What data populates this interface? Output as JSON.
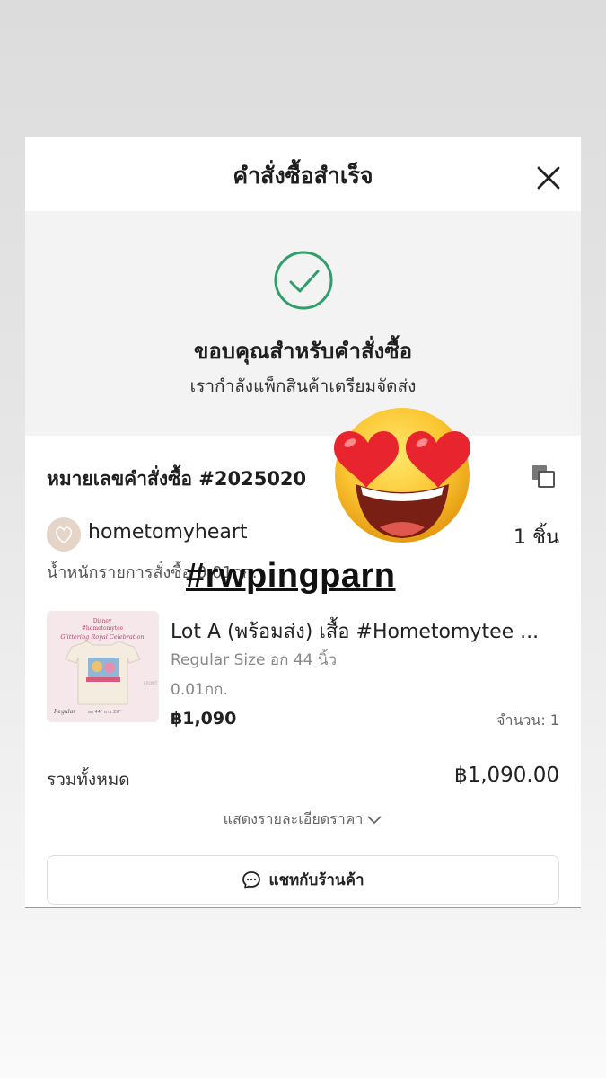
{
  "header": {
    "title": "คำสั่งซื้อสำเร็จ"
  },
  "confirmation": {
    "title": "ขอบคุณสำหรับคำสั่งซื้อ",
    "subtitle": "เรากำลังแพ็กสินค้าเตรียมจัดส่ง"
  },
  "order": {
    "number_label": "หมายเลขคำสั่งซื้อ #2025020",
    "shop_name": "hometomyheart",
    "item_count": "1 ชิ้น",
    "weight_line": "น้ำหนักรายการสั่งซื้อ 0.01กก."
  },
  "product": {
    "title": "Lot A (พร้อมส่ง) เสื้อ #Hometomytee ...",
    "variant": "Regular Size อก 44 นิ้ว",
    "weight": "0.01กก.",
    "price": "฿1,090",
    "quantity": "จำนวน: 1",
    "image_text": {
      "brand": "Disney",
      "collection": "#hometomytee",
      "name": "Glittering Royal Celebration",
      "size": "Regular",
      "measure": "อก 44\" ยาว 29\"",
      "side": "FRONT"
    }
  },
  "summary": {
    "total_label": "รวมทั้งหมด",
    "total_value": "฿1,090.00",
    "show_details": "แสดงรายละเอียดราคา"
  },
  "actions": {
    "chat_label": "แชทกับร้านค้า"
  },
  "overlay": {
    "hashtag": "#rwpingparn",
    "emoji": "heart-eyes-emoji"
  },
  "colors": {
    "success_green": "#2e9e6a",
    "background_gray": "#f3f3f3"
  }
}
